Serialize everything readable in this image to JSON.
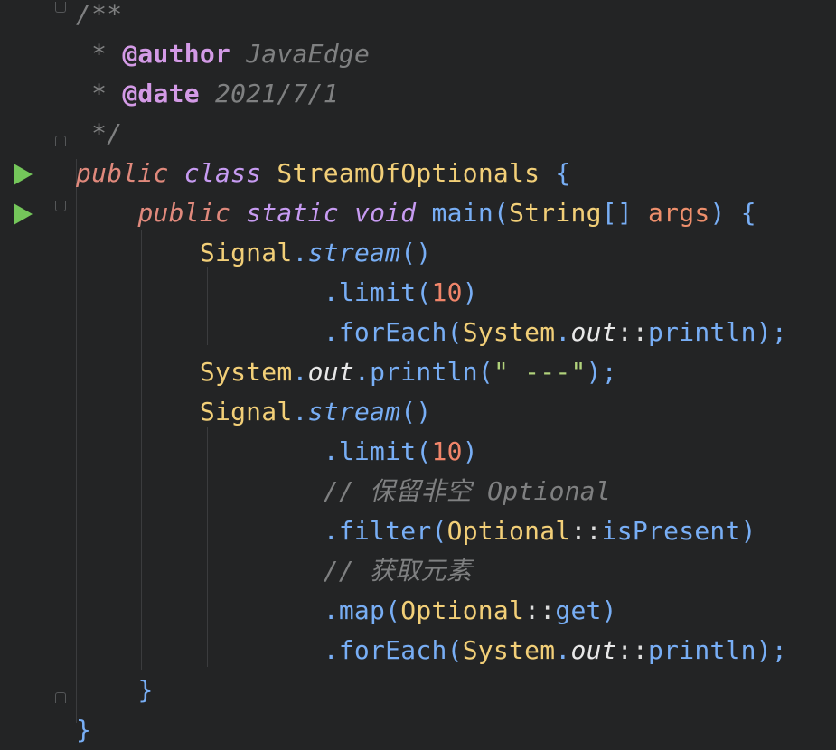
{
  "lines": [
    {
      "tokens": [
        {
          "t": "/**",
          "c": "c-comment"
        }
      ]
    },
    {
      "tokens": [
        {
          "t": " * ",
          "c": "c-comment"
        },
        {
          "t": "@author",
          "c": "c-doctag"
        },
        {
          "t": " JavaEdge",
          "c": "c-docval"
        }
      ]
    },
    {
      "tokens": [
        {
          "t": " * ",
          "c": "c-comment"
        },
        {
          "t": "@date",
          "c": "c-doctag"
        },
        {
          "t": " 2021/7/1",
          "c": "c-docval"
        }
      ]
    },
    {
      "tokens": [
        {
          "t": " */",
          "c": "c-comment"
        }
      ]
    },
    {
      "tokens": [
        {
          "t": "public",
          "c": "c-kw"
        },
        {
          "t": " "
        },
        {
          "t": "class",
          "c": "c-kw2"
        },
        {
          "t": " "
        },
        {
          "t": "StreamOfOptionals",
          "c": "c-class"
        },
        {
          "t": " {",
          "c": "c-punct"
        }
      ]
    },
    {
      "tokens": [
        {
          "t": "    "
        },
        {
          "t": "public",
          "c": "c-kw"
        },
        {
          "t": " "
        },
        {
          "t": "static",
          "c": "c-kw2"
        },
        {
          "t": " "
        },
        {
          "t": "void",
          "c": "c-kw2"
        },
        {
          "t": " "
        },
        {
          "t": "main",
          "c": "c-method"
        },
        {
          "t": "(",
          "c": "c-punct"
        },
        {
          "t": "String",
          "c": "c-class"
        },
        {
          "t": "[]",
          "c": "c-punct"
        },
        {
          "t": " "
        },
        {
          "t": "args",
          "c": "c-param"
        },
        {
          "t": ") {",
          "c": "c-punct"
        }
      ]
    },
    {
      "tokens": [
        {
          "t": "        "
        },
        {
          "t": "Signal",
          "c": "c-class"
        },
        {
          "t": ".",
          "c": "c-punct"
        },
        {
          "t": "stream",
          "c": "c-static"
        },
        {
          "t": "()",
          "c": "c-punct"
        }
      ]
    },
    {
      "tokens": [
        {
          "t": "                "
        },
        {
          "t": ".",
          "c": "c-punct"
        },
        {
          "t": "limit",
          "c": "c-method"
        },
        {
          "t": "(",
          "c": "c-punct"
        },
        {
          "t": "10",
          "c": "c-num"
        },
        {
          "t": ")",
          "c": "c-punct"
        }
      ]
    },
    {
      "tokens": [
        {
          "t": "                "
        },
        {
          "t": ".",
          "c": "c-punct"
        },
        {
          "t": "forEach",
          "c": "c-method"
        },
        {
          "t": "(",
          "c": "c-punct"
        },
        {
          "t": "System",
          "c": "c-class"
        },
        {
          "t": ".",
          "c": "c-punct"
        },
        {
          "t": "out",
          "c": "c-field"
        },
        {
          "t": "::",
          "c": "c-op"
        },
        {
          "t": "println",
          "c": "c-method"
        },
        {
          "t": ");",
          "c": "c-punct"
        }
      ]
    },
    {
      "tokens": [
        {
          "t": "        "
        },
        {
          "t": "System",
          "c": "c-class"
        },
        {
          "t": ".",
          "c": "c-punct"
        },
        {
          "t": "out",
          "c": "c-field"
        },
        {
          "t": ".",
          "c": "c-punct"
        },
        {
          "t": "println",
          "c": "c-method"
        },
        {
          "t": "(",
          "c": "c-punct"
        },
        {
          "t": "\" ---\"",
          "c": "c-str"
        },
        {
          "t": ");",
          "c": "c-punct"
        }
      ]
    },
    {
      "tokens": [
        {
          "t": "        "
        },
        {
          "t": "Signal",
          "c": "c-class"
        },
        {
          "t": ".",
          "c": "c-punct"
        },
        {
          "t": "stream",
          "c": "c-static"
        },
        {
          "t": "()",
          "c": "c-punct"
        }
      ]
    },
    {
      "tokens": [
        {
          "t": "                "
        },
        {
          "t": ".",
          "c": "c-punct"
        },
        {
          "t": "limit",
          "c": "c-method"
        },
        {
          "t": "(",
          "c": "c-punct"
        },
        {
          "t": "10",
          "c": "c-num"
        },
        {
          "t": ")",
          "c": "c-punct"
        }
      ]
    },
    {
      "tokens": [
        {
          "t": "                "
        },
        {
          "t": "// 保留非空 ",
          "c": "c-comment"
        },
        {
          "t": "Optional",
          "c": "c-ital"
        }
      ]
    },
    {
      "tokens": [
        {
          "t": "                "
        },
        {
          "t": ".",
          "c": "c-punct"
        },
        {
          "t": "filter",
          "c": "c-method"
        },
        {
          "t": "(",
          "c": "c-punct"
        },
        {
          "t": "Optional",
          "c": "c-class"
        },
        {
          "t": "::",
          "c": "c-op"
        },
        {
          "t": "isPresent",
          "c": "c-method"
        },
        {
          "t": ")",
          "c": "c-punct"
        }
      ]
    },
    {
      "tokens": [
        {
          "t": "                "
        },
        {
          "t": "// 获取元素",
          "c": "c-comment"
        }
      ]
    },
    {
      "tokens": [
        {
          "t": "                "
        },
        {
          "t": ".",
          "c": "c-punct"
        },
        {
          "t": "map",
          "c": "c-method"
        },
        {
          "t": "(",
          "c": "c-punct"
        },
        {
          "t": "Optional",
          "c": "c-class"
        },
        {
          "t": "::",
          "c": "c-op"
        },
        {
          "t": "get",
          "c": "c-method"
        },
        {
          "t": ")",
          "c": "c-punct"
        }
      ]
    },
    {
      "tokens": [
        {
          "t": "                "
        },
        {
          "t": ".",
          "c": "c-punct"
        },
        {
          "t": "forEach",
          "c": "c-method"
        },
        {
          "t": "(",
          "c": "c-punct"
        },
        {
          "t": "System",
          "c": "c-class"
        },
        {
          "t": ".",
          "c": "c-punct"
        },
        {
          "t": "out",
          "c": "c-field"
        },
        {
          "t": "::",
          "c": "c-op"
        },
        {
          "t": "println",
          "c": "c-method"
        },
        {
          "t": ");",
          "c": "c-punct"
        }
      ]
    },
    {
      "tokens": [
        {
          "t": "    "
        },
        {
          "t": "}",
          "c": "c-punct"
        }
      ]
    },
    {
      "tokens": [
        {
          "t": "}",
          "c": "c-punct"
        }
      ]
    }
  ],
  "gutter": {
    "run_lines": [
      4,
      5
    ],
    "fold_open_lines": [
      0,
      5
    ],
    "fold_end_lines": [
      3,
      17
    ]
  },
  "colors": {
    "background": "#232425",
    "run_icon": "#74c65a"
  }
}
